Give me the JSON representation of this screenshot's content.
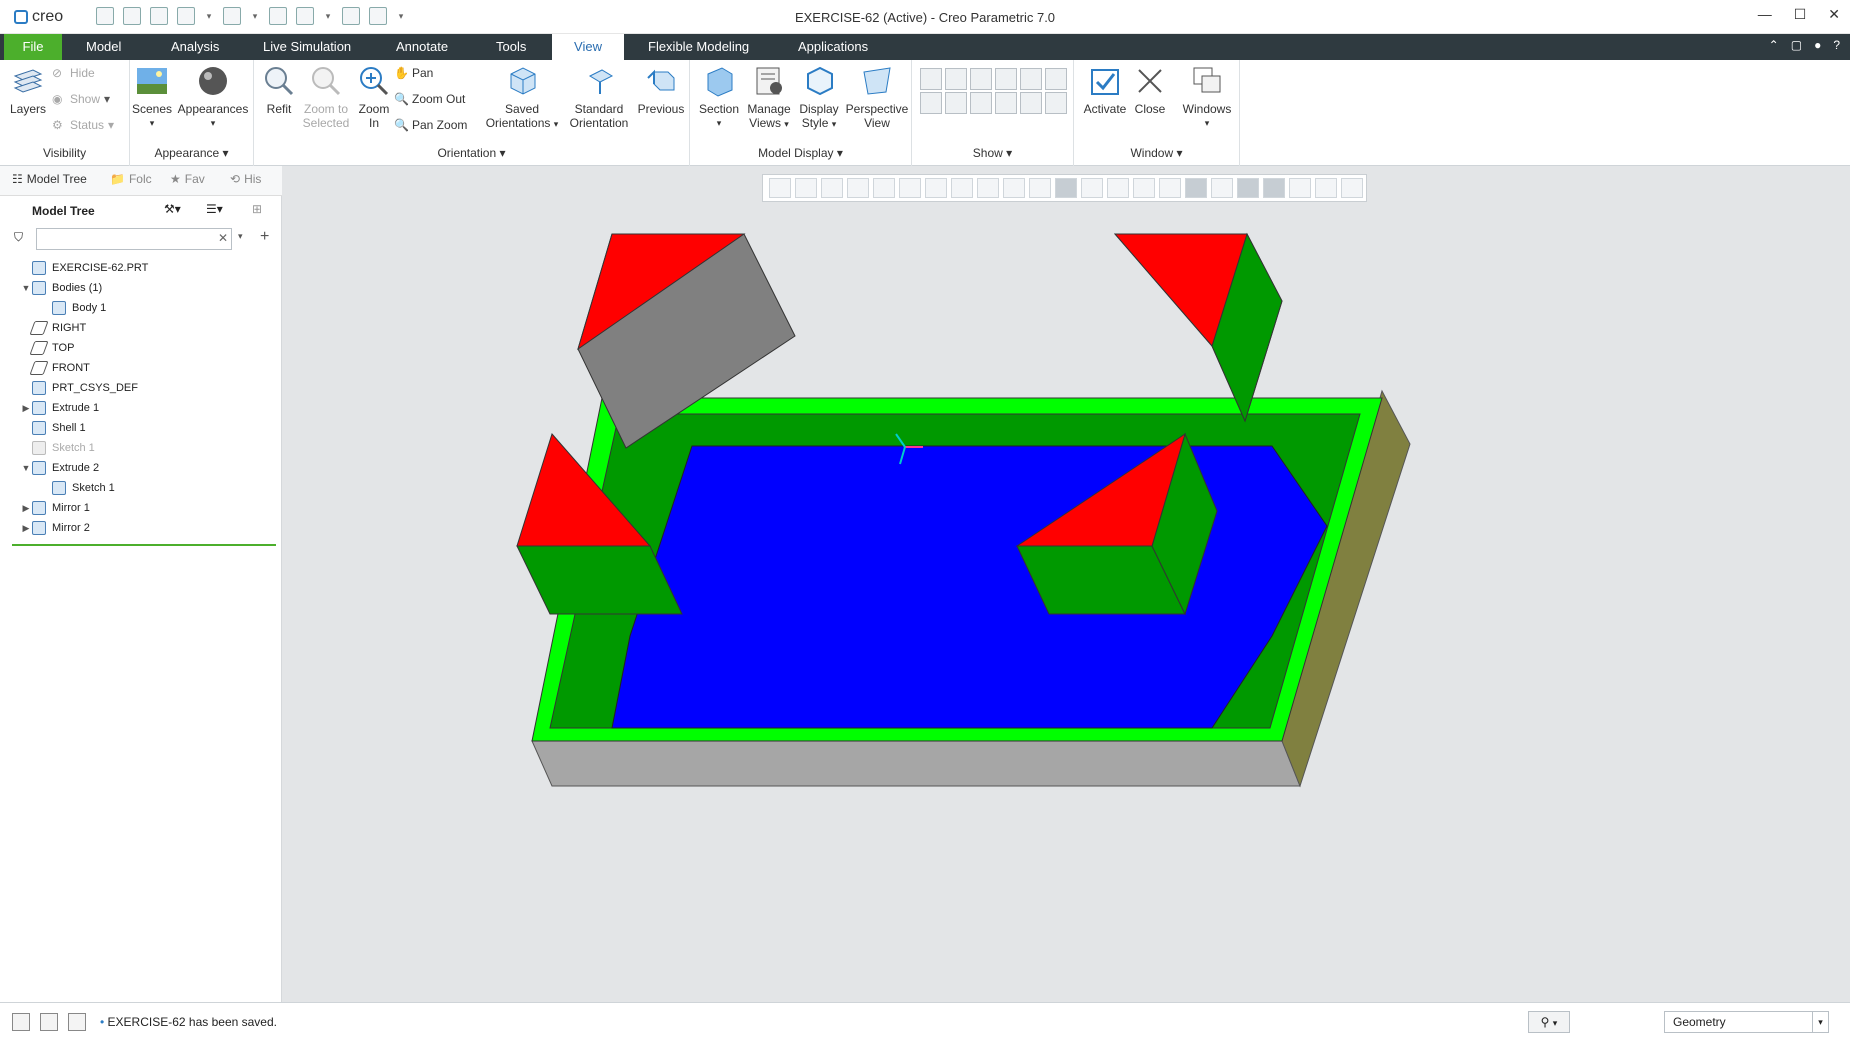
{
  "app": {
    "logo_text": "creo",
    "window_title": "EXERCISE-62 (Active) - Creo Parametric 7.0"
  },
  "ribbon_tabs": [
    "File",
    "Model",
    "Analysis",
    "Live Simulation",
    "Annotate",
    "Tools",
    "View",
    "Flexible Modeling",
    "Applications"
  ],
  "active_tab": "View",
  "groups": {
    "visibility": {
      "label": "Visibility",
      "layers": "Layers",
      "hide": "Hide",
      "show": "Show",
      "status": "Status"
    },
    "appearance": {
      "label": "Appearance",
      "scenes": "Scenes",
      "appearances": "Appearances"
    },
    "orientation": {
      "label": "Orientation",
      "refit": "Refit",
      "zoom_to_selected": "Zoom to Selected",
      "zoom_in": "Zoom In",
      "pan": "Pan",
      "zoom_out": "Zoom Out",
      "pan_zoom": "Pan Zoom",
      "saved_orientations": "Saved Orientations",
      "standard_orientation": "Standard Orientation",
      "previous": "Previous"
    },
    "model_display": {
      "label": "Model Display",
      "section": "Section",
      "manage_views": "Manage Views",
      "display_style": "Display Style",
      "perspective_view": "Perspective View"
    },
    "show": {
      "label": "Show"
    },
    "window": {
      "label": "Window",
      "activate": "Activate",
      "close": "Close",
      "windows": "Windows"
    }
  },
  "panel_tabs": [
    "Model Tree",
    "Folc",
    "Fav",
    "His"
  ],
  "tree": {
    "title": "Model Tree",
    "filter_placeholder": "",
    "items": [
      {
        "label": "EXERCISE-62.PRT",
        "expander": "",
        "indent": 0
      },
      {
        "label": "Bodies (1)",
        "expander": "▼",
        "indent": 0
      },
      {
        "label": "Body 1",
        "expander": "",
        "indent": 1
      },
      {
        "label": "RIGHT",
        "expander": "",
        "indent": 0
      },
      {
        "label": "TOP",
        "expander": "",
        "indent": 0
      },
      {
        "label": "FRONT",
        "expander": "",
        "indent": 0
      },
      {
        "label": "PRT_CSYS_DEF",
        "expander": "",
        "indent": 0
      },
      {
        "label": "Extrude 1",
        "expander": "▶",
        "indent": 0
      },
      {
        "label": "Shell 1",
        "expander": "",
        "indent": 0
      },
      {
        "label": "Sketch 1",
        "expander": "",
        "indent": 0,
        "disabled": true
      },
      {
        "label": "Extrude 2",
        "expander": "▼",
        "indent": 0
      },
      {
        "label": "Sketch 1",
        "expander": "",
        "indent": 1
      },
      {
        "label": "Mirror 1",
        "expander": "▶",
        "indent": 0
      },
      {
        "label": "Mirror 2",
        "expander": "▶",
        "indent": 0
      }
    ]
  },
  "status": {
    "message": "EXERCISE-62 has been saved.",
    "selection_filter": "Geometry"
  },
  "colors": {
    "floor": "#0000ff",
    "wall_top": "#00ff00",
    "wall_inner": "#009900",
    "block_top": "#ff0000",
    "block_side_gray": "#808080",
    "base_front": "#a6a6a6",
    "base_side": "#808040"
  }
}
